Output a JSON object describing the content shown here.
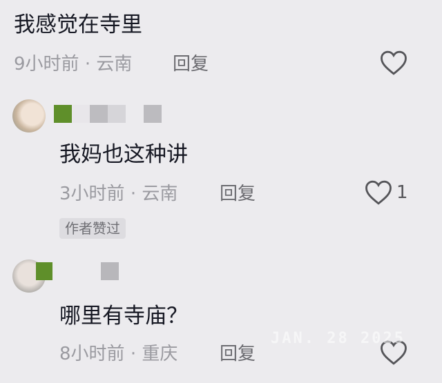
{
  "comments": [
    {
      "text": "我感觉在寺里",
      "time": "9小时前",
      "separator": "·",
      "location": "云南",
      "reply_label": "回复",
      "like_count": ""
    },
    {
      "text": "我妈也这种讲",
      "time": "3小时前",
      "separator": "·",
      "location": "云南",
      "reply_label": "回复",
      "like_count": "1",
      "badge": "作者赞过"
    },
    {
      "text": "哪里有寺庙？",
      "time": "8小时前",
      "separator": "·",
      "location": "重庆",
      "reply_label": "回复",
      "like_count": ""
    }
  ],
  "watermark": "JAN. 28 2025",
  "colors": {
    "background": "#ecebee",
    "text": "#161823",
    "meta": "#9a9aa0",
    "mosaic_green": "#5f8f2a"
  },
  "icons": [
    "heart-outline-icon",
    "avatar"
  ]
}
